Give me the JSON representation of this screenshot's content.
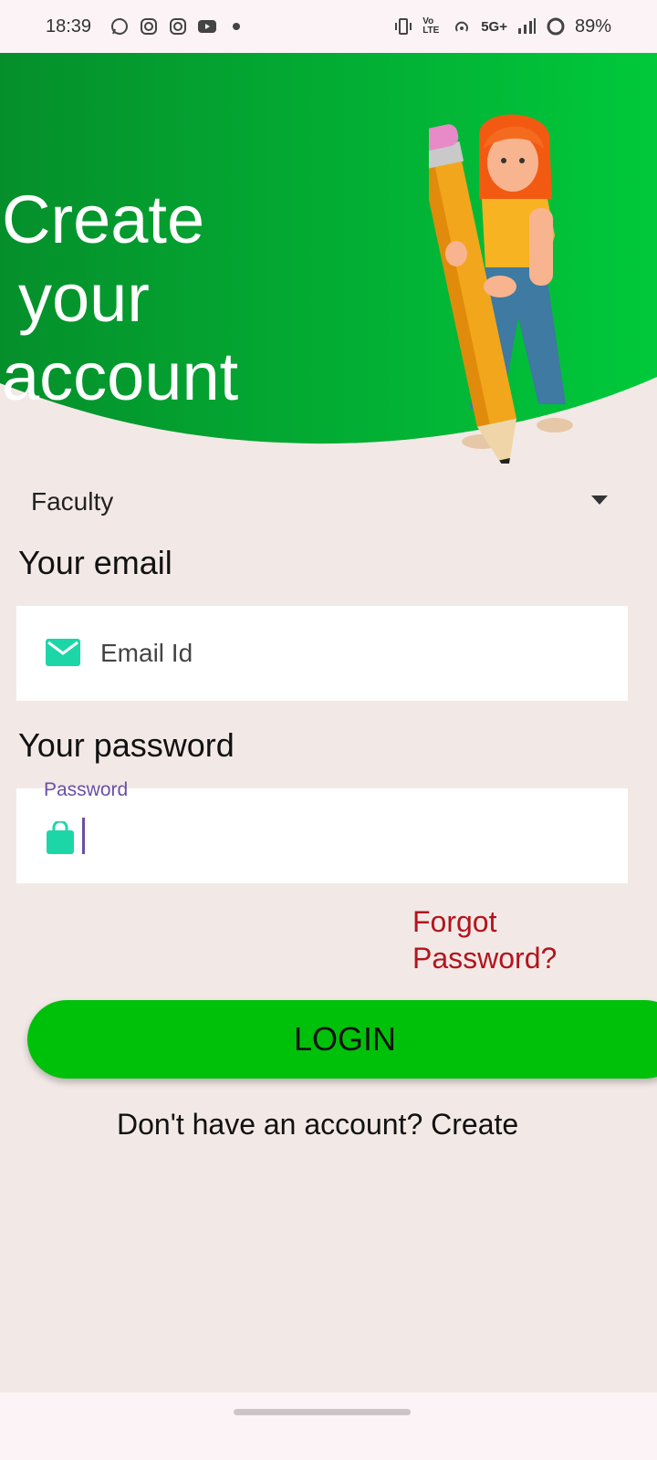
{
  "status_bar": {
    "time": "18:39",
    "network": "5G+",
    "volte": "Vo LTE",
    "battery": "89%",
    "left_icons": [
      "whatsapp-icon",
      "instagram-icon",
      "instagram-icon",
      "youtube-icon",
      "dot-icon"
    ],
    "right_icons": [
      "vibrate-icon",
      "volte-icon",
      "hotspot-icon",
      "signal-icon",
      "battery-ring-icon"
    ]
  },
  "header": {
    "title_lines": [
      "Create",
      "your",
      "account"
    ],
    "bg_color_start": "#058f2b",
    "bg_color_end": "#00c93b"
  },
  "form": {
    "role_select": "Faculty",
    "email_label": "Your email",
    "email_placeholder": "Email Id",
    "password_label": "Your password",
    "password_floating_label": "Password",
    "forgot_line1": "Forgot",
    "forgot_line2": "Password?",
    "login_button": "LOGIN",
    "signup_prompt": "Don't have an account? Create"
  },
  "colors": {
    "accent_green": "#00c10a",
    "icon_teal": "#1dd6a8",
    "forgot_red": "#b3141d",
    "focus_purple": "#6a4fa6"
  }
}
